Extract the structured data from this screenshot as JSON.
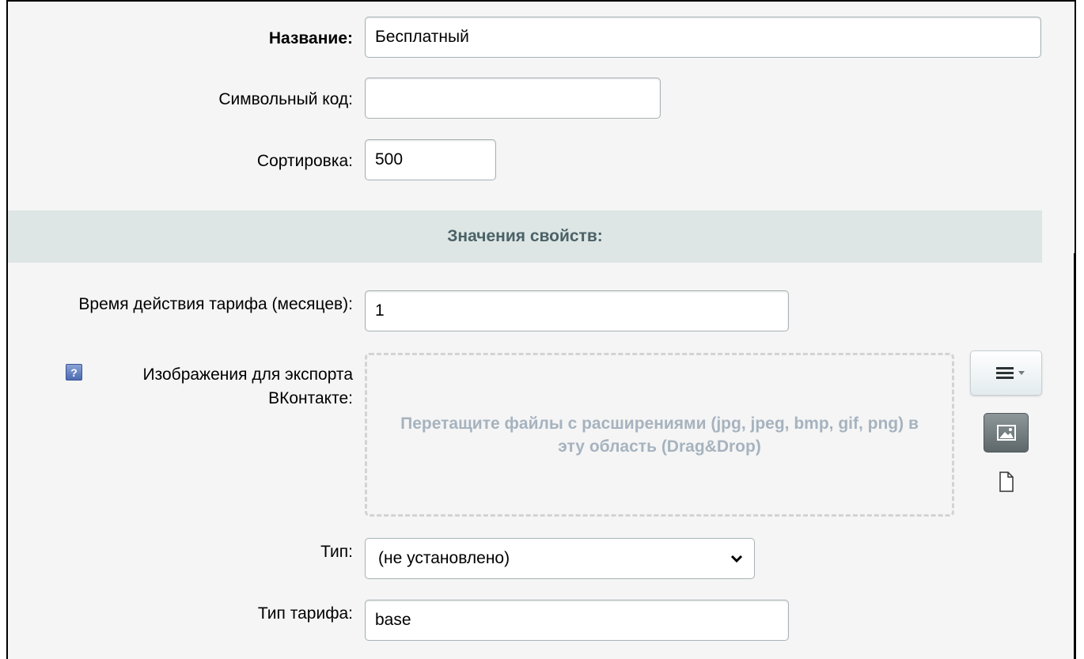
{
  "fields": {
    "name": {
      "label": "Название:",
      "value": "Бесплатный"
    },
    "code": {
      "label": "Символьный код:",
      "value": ""
    },
    "sort": {
      "label": "Сортировка:",
      "value": "500"
    }
  },
  "section": {
    "title": "Значения свойств:"
  },
  "properties": {
    "duration": {
      "label": "Время действия тарифа (месяцев):",
      "value": "1"
    },
    "images": {
      "help_glyph": "?",
      "label_line1": "Изображения для экспорта",
      "label_line2": "ВКонтакте:",
      "dropzone_text": "Перетащите файлы с расширениями (jpg, jpeg, bmp, gif, png) в эту область (Drag&Drop)",
      "icons": [
        "menu-lines-icon",
        "image-icon",
        "file-icon"
      ]
    },
    "type": {
      "label": "Тип:",
      "selected": "(не установлено)"
    },
    "tariff_type": {
      "label": "Тип тарифа:",
      "value": "base"
    }
  },
  "colors": {
    "panel": "#f5f5f5",
    "section_bg": "#dde6e5",
    "section_text": "#4b6267",
    "dropzone_text": "#a6b3bf"
  }
}
